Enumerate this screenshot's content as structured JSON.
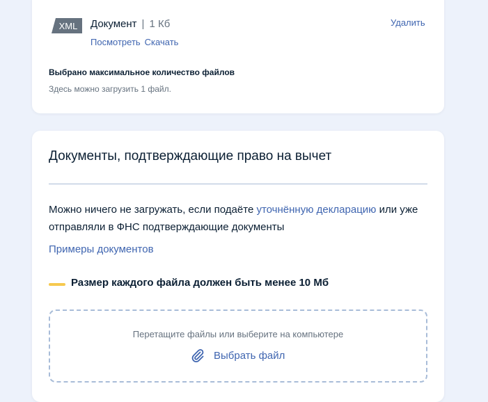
{
  "file": {
    "type_badge": "XML",
    "name": "Документ",
    "separator": "|",
    "size": "1 Кб",
    "view_label": "Посмотреть",
    "download_label": "Скачать",
    "delete_label": "Удалить"
  },
  "upload_status": {
    "title": "Выбрано максимальное количество файлов",
    "subtitle": "Здесь можно загрузить 1 файл."
  },
  "section": {
    "title": "Документы, подтверждающие право на вычет",
    "description_part1": "Можно ничего не загружать, если подаёте ",
    "description_link": "уточнённую декларацию",
    "description_part2": " или уже отправляли в ФНС подтверждающие документы",
    "examples_link": "Примеры документов",
    "size_warning": "Размер каждого файла должен быть менее 10 Мб",
    "dropzone_hint": "Перетащите файлы или выберите на компьютере",
    "choose_file_label": "Выбрать файл"
  },
  "icons": {
    "badge": "xml-file-icon",
    "attach": "paperclip-icon"
  },
  "colors": {
    "background": "#edf2fb",
    "link": "#3f65b0",
    "warning_accent": "#f6c94f",
    "badge": "#66727f"
  }
}
